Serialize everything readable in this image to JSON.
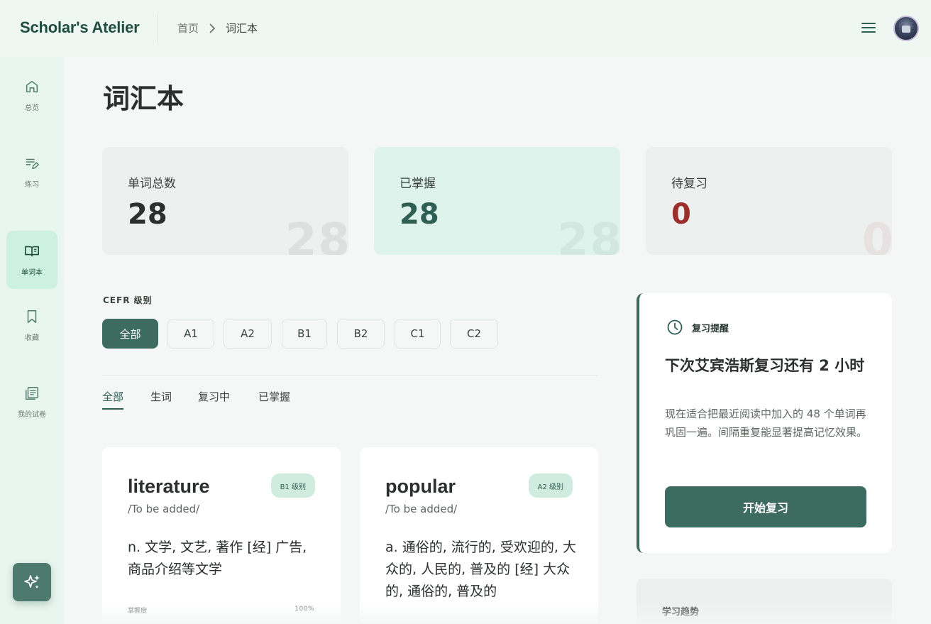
{
  "header": {
    "brand": "Scholar's Atelier",
    "breadcrumb": [
      "首页",
      "词汇本"
    ]
  },
  "sidebar": {
    "items": [
      {
        "label": "总览",
        "icon": "home-icon"
      },
      {
        "label": "练习",
        "icon": "edit-list-icon"
      },
      {
        "label": "单词本",
        "icon": "book-icon",
        "active": true
      },
      {
        "label": "收藏",
        "icon": "bookmark-icon"
      },
      {
        "label": "我的试卷",
        "icon": "papers-icon"
      }
    ],
    "ai_icon": "sparkles-icon"
  },
  "page": {
    "title": "词汇本"
  },
  "stats": [
    {
      "label": "单词总数",
      "value": "28"
    },
    {
      "label": "已掌握",
      "value": "28"
    },
    {
      "label": "待复习",
      "value": "0"
    }
  ],
  "filters": {
    "cefr_label": "CEFR 级别",
    "levels": [
      "全部",
      "A1",
      "A2",
      "B1",
      "B2",
      "C1",
      "C2"
    ],
    "active_level": "全部",
    "tabs": [
      "全部",
      "生词",
      "复习中",
      "已掌握"
    ],
    "active_tab": "全部"
  },
  "words": [
    {
      "word": "literature",
      "phonetic": "/To be added/",
      "badge": "B1 级别",
      "definition": "n. 文学, 文艺, 著作 [经] 广告, 商品介绍等文学",
      "mastery_label": "掌握度",
      "mastery_value": "100%"
    },
    {
      "word": "popular",
      "phonetic": "/To be added/",
      "badge": "A2 级别",
      "definition": "a. 通俗的, 流行的, 受欢迎的, 大众的, 人民的, 普及的 [经] 大众的, 通俗的, 普及的"
    }
  ],
  "reminder": {
    "tag": "复习提醒",
    "title": "下次艾宾浩斯复习还有 2 小时",
    "body": "现在适合把最近阅读中加入的 48 个单词再巩固一遍。间隔重复能显著提高记忆效果。",
    "button": "开始复习"
  },
  "trend": {
    "label": "学习趋势"
  },
  "colors": {
    "accent": "#3d6b60",
    "brand": "#1f4d40",
    "danger": "#9c2e2e",
    "mint": "#def3eb"
  }
}
